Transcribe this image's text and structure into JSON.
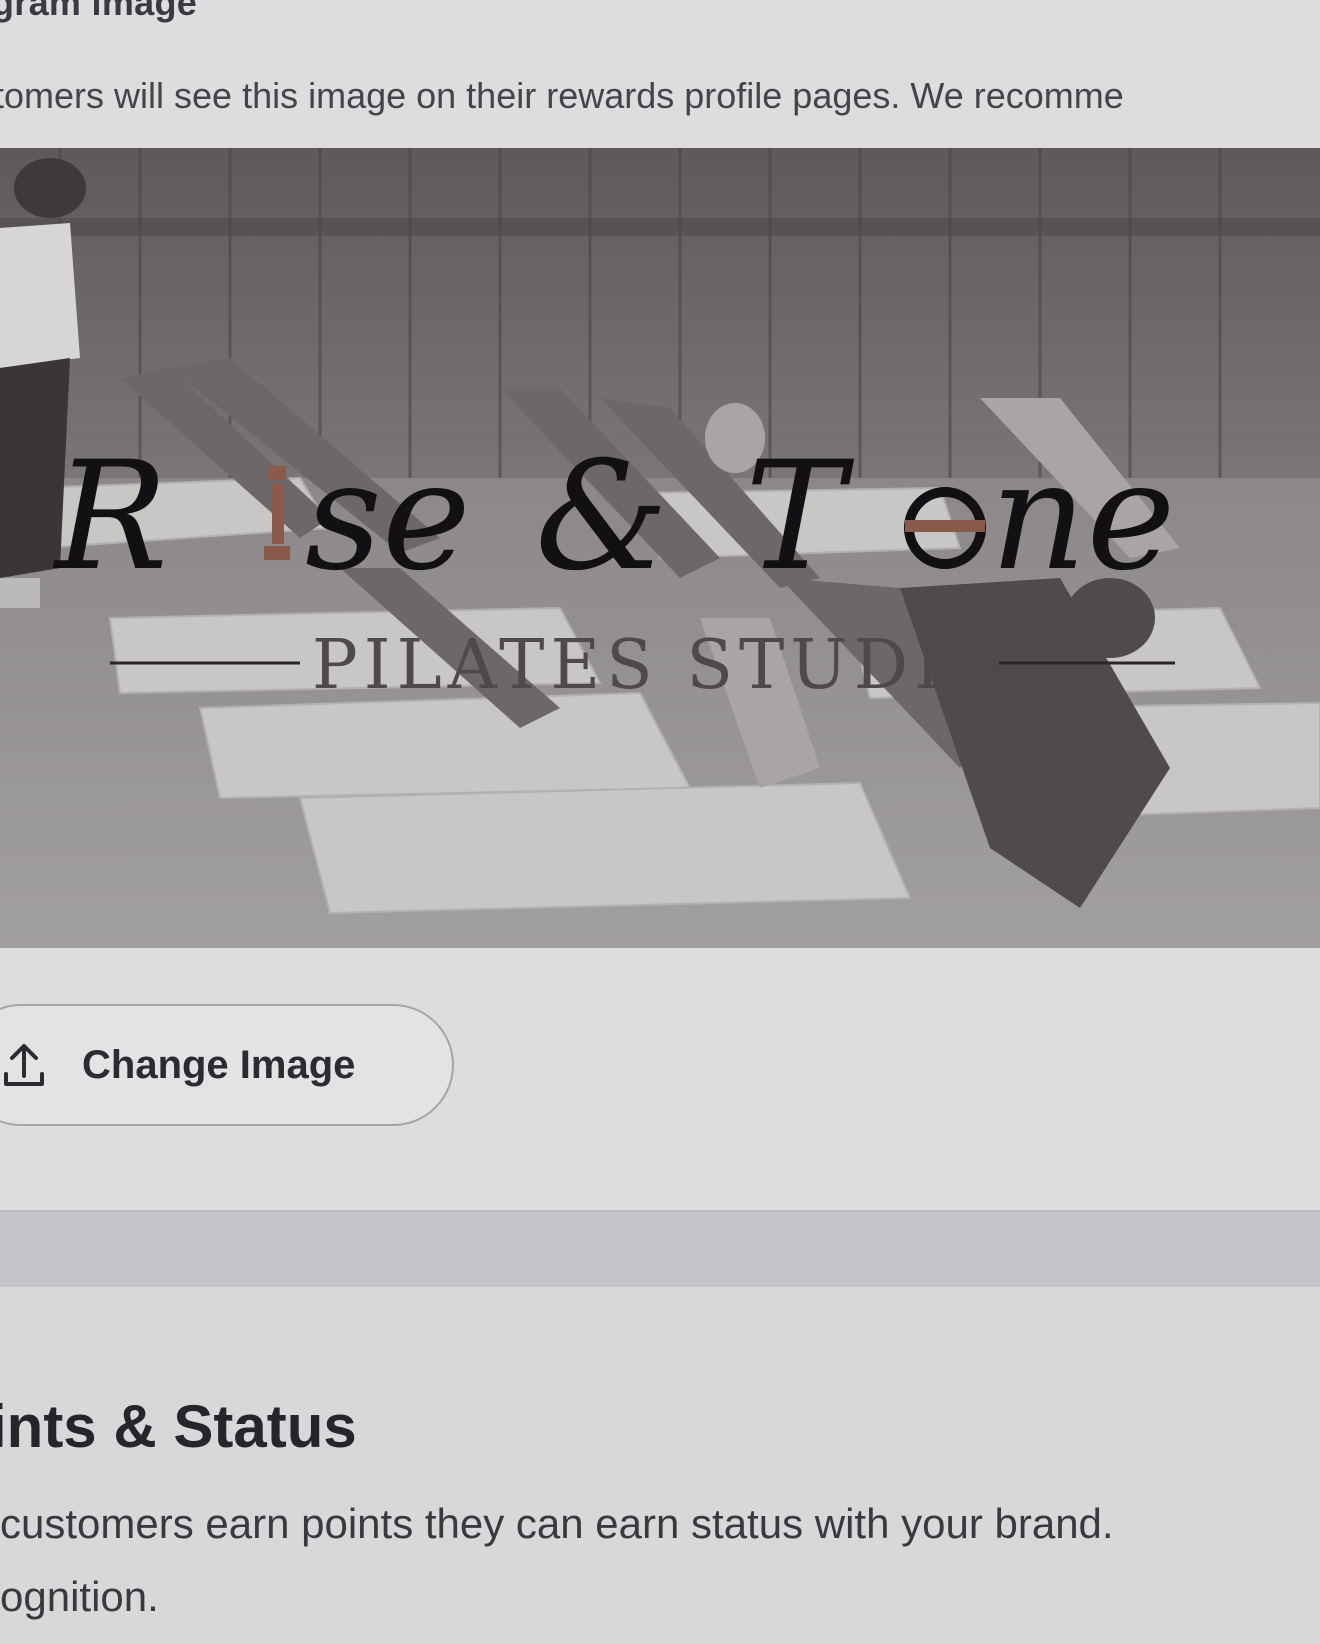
{
  "program_image_section": {
    "title": "gram image",
    "description": "tomers will see this image on their rewards profile pages. We recomme",
    "banner": {
      "logo_script": "Rise & Tone",
      "logo_subtitle": "PILATES STUDIO"
    },
    "change_button_label": "Change Image",
    "change_button_icon": "upload-icon"
  },
  "points_status_section": {
    "title": "ints & Status",
    "description_line_1": "customers earn points they can earn status with your brand.",
    "description_line_2": "ognition."
  },
  "colors": {
    "page_background": "#d3d1d5",
    "card_background": "#dedcdf",
    "text_primary": "#26262a",
    "logo_accent": "#8a5a4a"
  }
}
